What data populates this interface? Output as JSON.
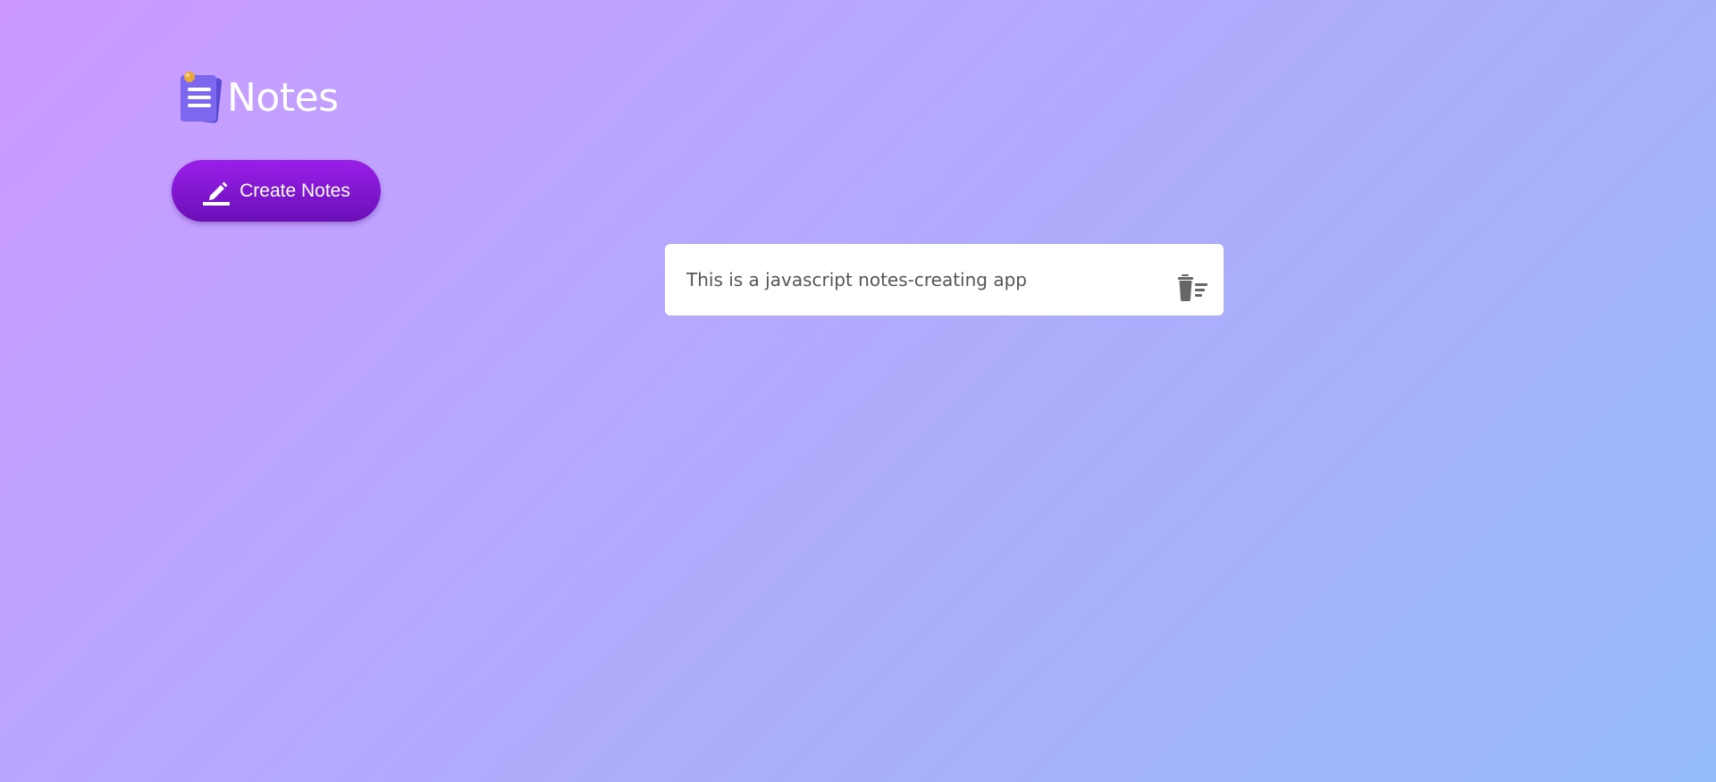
{
  "app": {
    "title": "Notes",
    "logo_icon": "notes-logo-icon"
  },
  "toolbar": {
    "create_label": "Create Notes",
    "create_icon": "pencil-icon"
  },
  "notes": [
    {
      "text": "This is a javascript notes-creating app",
      "delete_icon": "trash-icon"
    }
  ],
  "colors": {
    "button_top": "#9a1fe8",
    "button_bottom": "#6a0fb8",
    "background_start": "#cc99ff",
    "background_end": "#96bcfb",
    "note_text": "#555555",
    "card": "#ffffff"
  }
}
